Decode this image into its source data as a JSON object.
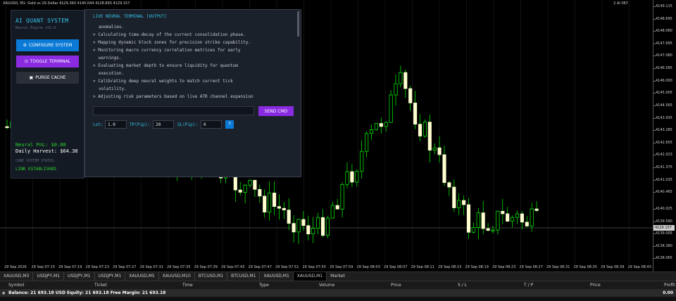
{
  "chart_header": {
    "text": "XAUUSD, M1: Gold vs US Dollar  4129.363 4140.044 4128.893 4129.157",
    "right_text": "2 AI 067"
  },
  "price_axis": {
    "labels": [
      "4149.115",
      "4148.695",
      "4148.060",
      "4147.695",
      "4147.080",
      "4146.585",
      "4146.000",
      "4145.005",
      "4144.565",
      "4143.935",
      "4143.285",
      "4142.655",
      "4142.023",
      "4141.375",
      "4141.035",
      "4140.465",
      "4140.025",
      "4139.590",
      "4139.005",
      "4138.380",
      "4138.065"
    ],
    "current": "4129.157"
  },
  "time_axis": {
    "labels": [
      "29 Sep 2026",
      "29 Sep 07:15",
      "29 Sep 07:19",
      "29 Sep 07:23",
      "29 Sep 07:27",
      "29 Sep 07:31",
      "29 Sep 07:35",
      "29 Sep 07:39",
      "29 Sep 07:43",
      "29 Sep 07:47",
      "29 Sep 07:51",
      "29 Sep 07:55",
      "29 Sep 07:59",
      "29 Sep 08:03",
      "29 Sep 08:07",
      "29 Sep 08:11",
      "29 Sep 08:15",
      "29 Sep 08:19",
      "29 Sep 08:23",
      "29 Sep 08:27",
      "29 Sep 08:31",
      "29 Sep 08:35",
      "29 Sep 08:39",
      "29 Sep 08:43"
    ]
  },
  "symbol_tabs": [
    {
      "label": "XAUUSD,M3"
    },
    {
      "label": "USDJPY,M1"
    },
    {
      "label": "USDJPY,M1"
    },
    {
      "label": "USDJPY,M1"
    },
    {
      "label": "XAUUSD,M5"
    },
    {
      "label": "XAUUSD,M10"
    },
    {
      "label": "BTCUSD,M1"
    },
    {
      "label": "BTCUSD,M1"
    },
    {
      "label": "XAUUSD,M1"
    },
    {
      "label": "XAUUSD,M1"
    },
    {
      "label": "Market"
    }
  ],
  "terminal_columns": {
    "symbol": "Symbol",
    "ticket": "Ticket",
    "time": "Time",
    "type": "Type",
    "volume": "Volume",
    "price": "Price",
    "sl": "S / L",
    "tp": "T / P",
    "price2": "Price",
    "profit": "Profit"
  },
  "balance_row": {
    "text": "Balance: 21 693.18 USD  Equity: 21 693.18  Free Margin: 21 693.18",
    "value": "0.00"
  },
  "ai_panel": {
    "title": "AI QUANT SYSTEM",
    "subtitle": "Neural Engine v52.0",
    "buttons": {
      "configure": "CONFIGURE SYSTEM",
      "toggle": "TOGGLE TERMINAL",
      "purge": "PURGE CACHE"
    },
    "pnl": "Neural PnL: $0.00",
    "harvest": "Daily Harvest: $64.38",
    "core_label": "CORE SYSTEM STATUS:",
    "link_status": "LINK ESTABLISHED"
  },
  "terminal": {
    "title": "LIVE NEURAL TERMINAL [OUTPUT]",
    "lines": [
      {
        "text": "anomalies.",
        "cont": true
      },
      {
        "text": "> Calculating time-decay of the current consolidation phase.",
        "cont": false
      },
      {
        "text": "> Mapping dynamic block zones for precision strike capability.",
        "cont": false
      },
      {
        "text": "> Monitoring macro currency correlation matrices for early",
        "cont": false
      },
      {
        "text": "warnings.",
        "cont": true
      },
      {
        "text": "> Evaluating market depth to ensure liquidity for quantum",
        "cont": false
      },
      {
        "text": "execution.",
        "cont": true
      },
      {
        "text": "> Calibrating deep neural weights to match current tick",
        "cont": false
      },
      {
        "text": "volatility.",
        "cont": true
      },
      {
        "text": "> Adjusting risk parameters based on live ATR channel expansion",
        "cont": false
      }
    ],
    "cmd_value": "",
    "send_label": "SEND CMD",
    "lot_label": "Lot:",
    "lot_value": "1.0",
    "tp_label": "TP(Pip):",
    "tp_value": "20",
    "sl_label": "SL(Pip):",
    "sl_value": "0",
    "help_label": "?"
  },
  "colors": {
    "bull": "#ffffd0",
    "bear": "#ffffff",
    "wick": "#00ff00",
    "accent_cyan": "#33c2e6",
    "accent_blue": "#0a7ad6",
    "accent_purple": "#8a2be2",
    "neon_green": "#2bd02b"
  }
}
